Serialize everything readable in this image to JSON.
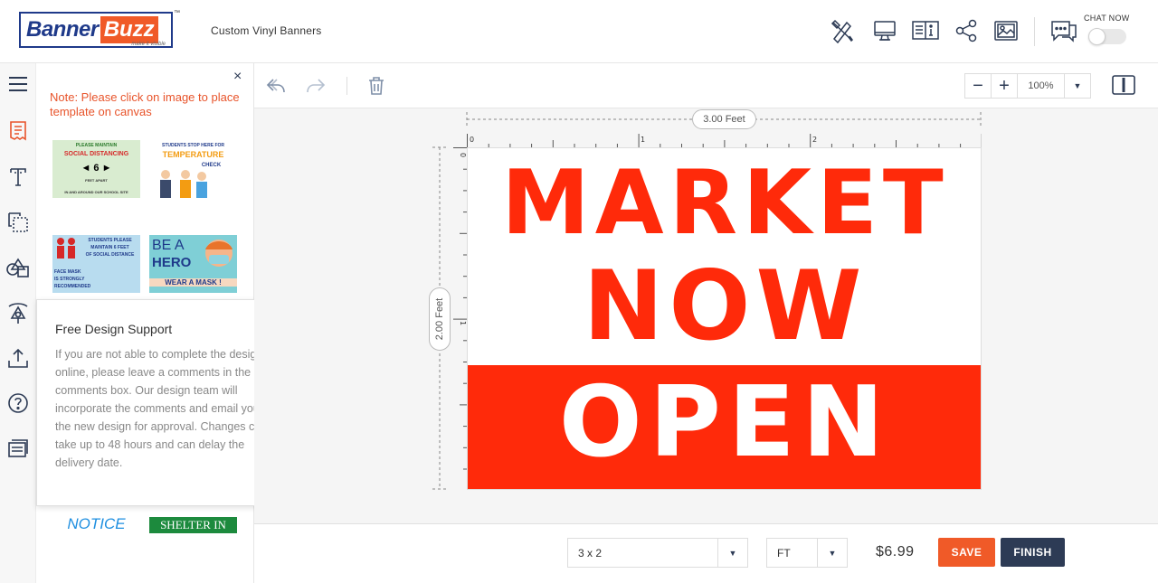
{
  "app": {
    "brand_part1": "Banner",
    "brand_part2": "Buzz",
    "brand_tagline": "make it visible",
    "trademark": "™",
    "product_title": "Custom Vinyl Banners",
    "chat_label": "CHAT NOW"
  },
  "header_icons": [
    "design-tools-icon",
    "desktop-icon",
    "preview-book-icon",
    "share-icon",
    "image-icon",
    "chat-icon"
  ],
  "colors": {
    "brand_blue": "#1f3a8a",
    "brand_orange": "#f05a28",
    "banner_red": "#ff2a0a",
    "note_orange": "#e8542b",
    "save_orange": "#f05a28",
    "finish_navy": "#2d3b55"
  },
  "rail_icons": [
    "menu-icon",
    "templates-icon",
    "text-icon",
    "layers-icon",
    "shapes-icon",
    "clipart-icon",
    "upload-icon",
    "help-icon",
    "comments-icon"
  ],
  "template_panel": {
    "close_label": "×",
    "note": "Note: Please click on image to place template on canvas",
    "templates": [
      {
        "lines": [
          "PLEASE MAINTAIN",
          "SOCIAL DISTANCING",
          "◄ 6 ►",
          "FEET APART",
          "IN AND AROUND OUR SCHOOL SITE"
        ]
      },
      {
        "lines": [
          "STUDENTS STOP HERE FOR",
          "TEMPERATURE",
          "CHECK"
        ]
      },
      {
        "lines": [
          "STUDENTS PLEASE",
          "MAINTAIN 6 FEET",
          "OF SOCIAL DISTANCE",
          "FACE MASK",
          "IS STRONGLY",
          "RECOMMENDED"
        ]
      },
      {
        "lines": [
          "BE A",
          "HERO",
          "WEAR A MASK !"
        ]
      },
      {
        "lines": [
          "NOTICE"
        ]
      },
      {
        "lines": [
          "SHELTER IN"
        ]
      }
    ]
  },
  "support_popup": {
    "title": "Free Design Support",
    "close_label": "×",
    "body": "If you are not able to complete the design online, please leave a comments in the comments box. Our design team will incorporate the comments and email you the new design for approval. Changes can take up to 48 hours and can delay the delivery date."
  },
  "toolbar": {
    "undo": "undo-icon",
    "redo": "redo-icon",
    "delete": "trash-icon",
    "zoom_minus": "−",
    "zoom_plus": "+",
    "zoom_value": "100%",
    "zoom_caret": "▼"
  },
  "canvas": {
    "width_label": "3.00 Feet",
    "height_label": "2.00 Feet",
    "ruler_top_labels": [
      "0",
      "1",
      "2"
    ],
    "ruler_left_labels": [
      "0",
      "1"
    ],
    "banner_lines": [
      "MARKET",
      "NOW",
      "OPEN"
    ]
  },
  "bottom_bar": {
    "size_value": "3 x 2",
    "unit_value": "FT",
    "caret": "▼",
    "price": "$6.99",
    "save_label": "SAVE",
    "finish_label": "FINISH"
  }
}
